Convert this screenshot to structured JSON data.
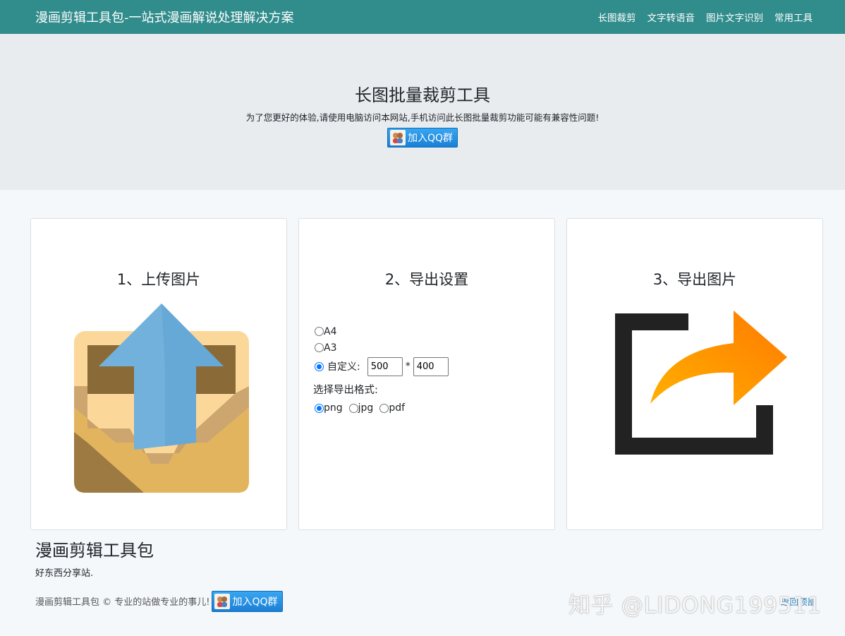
{
  "navbar": {
    "brand": "漫画剪辑工具包-一站式漫画解说处理解决方案",
    "links": [
      "长图裁剪",
      "文字转语音",
      "图片文字识别",
      "常用工具"
    ]
  },
  "hero": {
    "title": "长图批量裁剪工具",
    "notice": "为了您更好的体验,请使用电脑访问本网站,手机访问此长图批量裁剪功能可能有兼容性问题!",
    "qq_button": "加入QQ群"
  },
  "steps": {
    "upload_title": "1、上传图片",
    "settings_title": "2、导出设置",
    "export_title": "3、导出图片"
  },
  "settings": {
    "size_options": [
      "A4",
      "A3",
      "自定义:"
    ],
    "selected_size": "自定义:",
    "width_value": "500",
    "times_sign": "*",
    "height_value": "400",
    "format_label": "选择导出格式:",
    "format_options": [
      "png",
      "jpg",
      "pdf"
    ],
    "selected_format": "png"
  },
  "footer": {
    "title": "漫画剪辑工具包",
    "subtitle": "好东西分享站.",
    "copyright": "漫画剪辑工具包 © 专业的站做专业的事儿!",
    "qq_button": "加入QQ群",
    "back_to_top": "返回顶部"
  },
  "watermark": "知乎 @LIDONG199511",
  "colors": {
    "navbar": "#318c8c",
    "hero_bg": "#e8ecef",
    "page_bg": "#f5f8fb",
    "radio_checked": "#0075ff",
    "qq_button": "#1f8ae0"
  },
  "icons": [
    "upload-box-icon",
    "export-share-icon",
    "qq-face-icon"
  ]
}
